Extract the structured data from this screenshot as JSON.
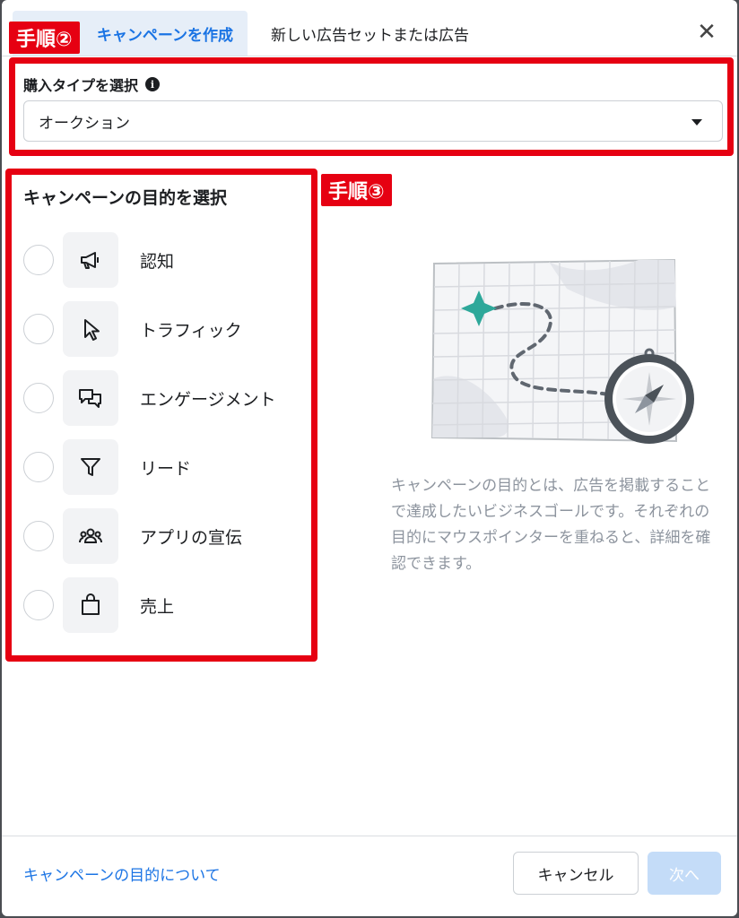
{
  "tabs": {
    "active_label": "キャンペーンを作成",
    "second_label": "新しい広告セットまたは広告",
    "close_glyph": "✕"
  },
  "annotations": {
    "step2": "手順②",
    "step3": "手順③",
    "color": "#e60012"
  },
  "purchase_type": {
    "label": "購入タイプを選択",
    "info_glyph": "i",
    "selected": "オークション"
  },
  "objectives": {
    "title": "キャンペーンの目的を選択",
    "items": [
      {
        "label": "認知",
        "icon": "megaphone-icon"
      },
      {
        "label": "トラフィック",
        "icon": "cursor-icon"
      },
      {
        "label": "エンゲージメント",
        "icon": "chat-bubbles-icon"
      },
      {
        "label": "リード",
        "icon": "funnel-icon"
      },
      {
        "label": "アプリの宣伝",
        "icon": "people-icon"
      },
      {
        "label": "売上",
        "icon": "shopping-bag-icon"
      }
    ],
    "description": "キャンペーンの目的とは、広告を掲載することで達成したいビジネスゴールです。それぞれの目的にマウスポインターを重ねると、詳細を確認できます。"
  },
  "footer": {
    "link": "キャンペーンの目的について",
    "cancel": "キャンセル",
    "next": "次へ"
  },
  "colors": {
    "accent": "#1b74e4",
    "next_disabled": "#c4dcf8"
  }
}
